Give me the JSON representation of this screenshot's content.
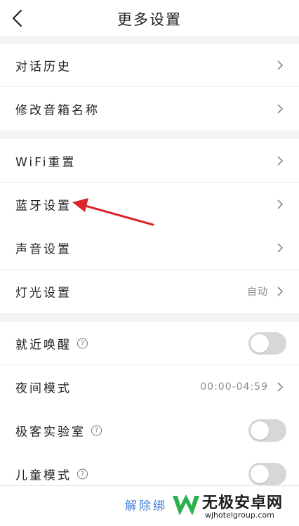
{
  "header": {
    "title": "更多设置"
  },
  "group1": [
    {
      "label": "对话历史"
    },
    {
      "label": "修改音箱名称"
    }
  ],
  "group2": [
    {
      "label": "WiFi重置"
    },
    {
      "label": "蓝牙设置"
    },
    {
      "label": "声音设置"
    },
    {
      "label": "灯光设置",
      "value": "自动"
    }
  ],
  "group3": [
    {
      "label": "就近唤醒",
      "toggle": false
    },
    {
      "label": "夜间模式",
      "value": "00:00-04:59"
    },
    {
      "label": "极客实验室",
      "toggle": false
    },
    {
      "label": "儿童模式",
      "toggle": false
    }
  ],
  "footer": {
    "unbind_label": "解除绑定"
  },
  "watermark": {
    "name": "无极安卓网",
    "url": "wjhotelgroup.com"
  },
  "icons": {
    "back": "back-chevron-icon",
    "row_arrow": "chevron-right-icon",
    "help": "question-circle-icon",
    "help_glyph": "?",
    "annotation": "red-arrow-annotation",
    "logo": "green-w-logo-icon"
  },
  "colors": {
    "accent": "#3d7bd8",
    "annotation": "#d8262b",
    "toggle_off": "#d7d7d7",
    "page_bg": "#f4f4f6",
    "logo": "#2bb24c"
  }
}
